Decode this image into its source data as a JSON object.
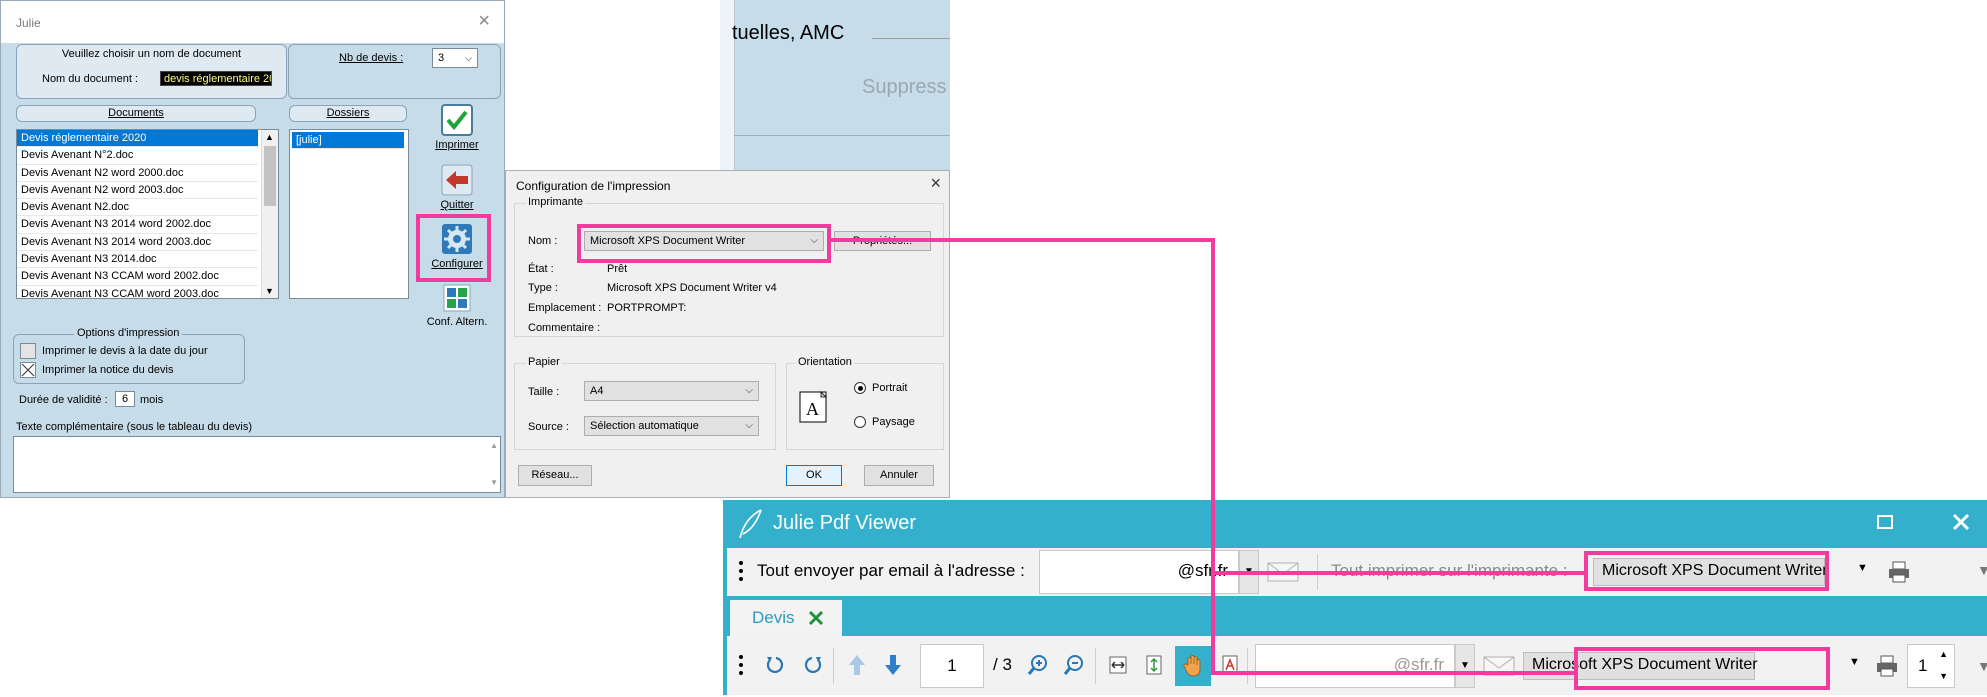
{
  "julie_dialog": {
    "title": "Julie",
    "close_glyph": "×",
    "doc_group_title": "Veuillez choisir un nom de document",
    "doc_name_label": "Nom du document :",
    "doc_name_value": "devis réglementaire 20",
    "nb_devis_label": "Nb de devis :",
    "nb_devis_value": "3",
    "documents_header": "Documents",
    "dossiers_header": "Dossiers",
    "documents": [
      "Devis réglementaire 2020",
      "Devis Avenant N°2.doc",
      "Devis Avenant N2 word 2000.doc",
      "Devis Avenant N2 word 2003.doc",
      "Devis Avenant N2.doc",
      "Devis Avenant N3 2014 word 2002.doc",
      "Devis Avenant N3 2014 word 2003.doc",
      "Devis Avenant N3 2014.doc",
      "Devis Avenant N3 CCAM word 2002.doc",
      "Devis Avenant N3 CCAM word 2003.doc"
    ],
    "dossiers": [
      "[julie]"
    ],
    "btn_imprimer": "Imprimer",
    "btn_quitter": "Quitter",
    "btn_configurer": "Configurer",
    "btn_conf_altern": "Conf. Altern.",
    "options_title": "Options d'impression",
    "opt_date": "Imprimer le devis à la date du jour",
    "opt_notice": "Imprimer la notice du devis",
    "opt_notice_checked": true,
    "validity_label": "Durée de validité :",
    "validity_value": "6",
    "validity_unit": "mois",
    "extra_text_label": "Texte complémentaire (sous le tableau du devis)"
  },
  "background_window": {
    "heading": "tuelles, AMC",
    "button": "Suppress"
  },
  "print_config": {
    "title": "Configuration de l'impression",
    "close_glyph": "×",
    "printer_group": "Imprimante",
    "name_label": "Nom :",
    "printer_name": "Microsoft XPS Document Writer",
    "properties_button": "Propriétés...",
    "state_label": "État :",
    "state_value": "Prêt",
    "type_label": "Type :",
    "type_value": "Microsoft XPS Document Writer v4",
    "location_label": "Emplacement :",
    "location_value": "PORTPROMPT:",
    "comment_label": "Commentaire :",
    "paper_group": "Papier",
    "size_label": "Taille :",
    "size_value": "A4",
    "source_label": "Source :",
    "source_value": "Sélection automatique",
    "orientation_group": "Orientation",
    "portrait": "Portrait",
    "landscape": "Paysage",
    "orientation_selected": "Portrait",
    "network_button": "Réseau...",
    "ok_button": "OK",
    "cancel_button": "Annuler"
  },
  "pdf_viewer": {
    "title": "Julie Pdf Viewer",
    "email_label": "Tout envoyer par email à l'adresse :",
    "email_value": "@sfr.fr",
    "print_all_label": "Tout imprimer sur l'imprimante :",
    "printer_top": "Microsoft XPS Document Writer",
    "tab_label": "Devis",
    "page_current": "1",
    "page_total": "/ 3",
    "email_value_2": "@sfr.fr",
    "printer_bottom": "Microsoft XPS Document Writer",
    "copies": "1"
  },
  "highlight_color": "#f03c9c",
  "accent_color": "#35b0cc"
}
